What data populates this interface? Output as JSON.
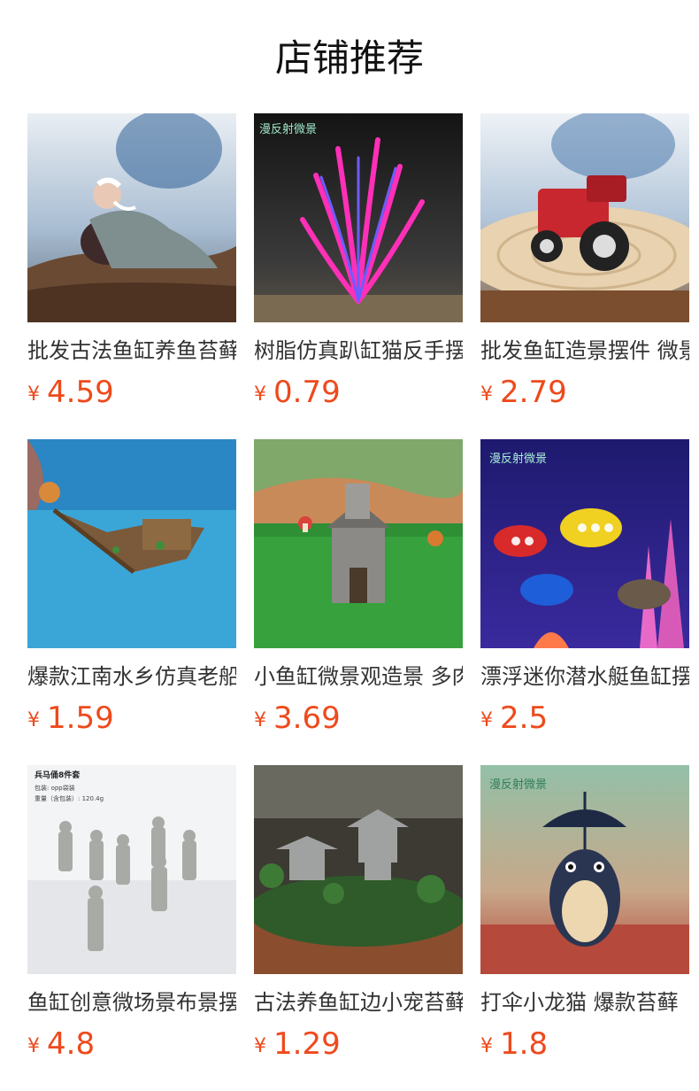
{
  "section": {
    "title": "店铺推荐"
  },
  "currency_symbol": "¥",
  "products": [
    {
      "name": "批发古法鱼缸养鱼苔藓",
      "price": "4.59",
      "image": "scholar-figurine-image"
    },
    {
      "name": "树脂仿真趴缸猫反手摆件",
      "price": "0.79",
      "image": "aquarium-plant-image"
    },
    {
      "name": "批发鱼缸造景摆件 微景观",
      "price": "2.79",
      "image": "tractor-figurine-image"
    },
    {
      "name": "爆款江南水乡仿真老船摆件",
      "price": "1.59",
      "image": "shipwreck-boat-image"
    },
    {
      "name": "小鱼缸微景观造景 多肉",
      "price": "3.69",
      "image": "lighthouse-house-image"
    },
    {
      "name": "漂浮迷你潜水艇鱼缸摆件",
      "price": "2.5",
      "image": "submarine-floats-image"
    },
    {
      "name": "鱼缸创意微场景布景摆件",
      "price": "4.8",
      "image": "terracotta-warriors-image"
    },
    {
      "name": "古法养鱼缸边小宠苔藓",
      "price": "1.29",
      "image": "pagoda-lantern-image"
    },
    {
      "name": "打伞小龙猫 爆款苔藓",
      "price": "1.8",
      "image": "totoro-umbrella-image"
    }
  ],
  "watermark_text": "漫反射微景",
  "catalog_card_lines": [
    "兵马俑8件套",
    "包装: opp袋装",
    "重量（含包装）: 120.4g"
  ],
  "colors": {
    "price": "#ee4a1c",
    "title": "#111111",
    "name": "#333333"
  }
}
